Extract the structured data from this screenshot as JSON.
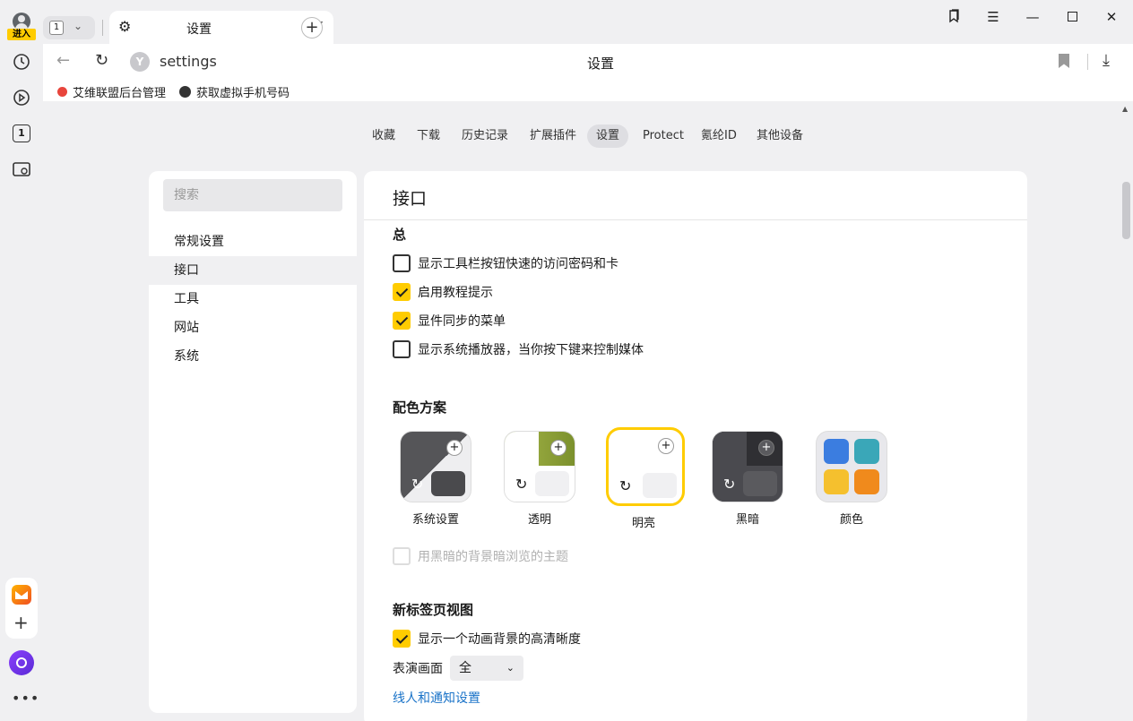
{
  "rail": {
    "enter_badge": "进入",
    "items": [
      "history-icon",
      "media-play-icon",
      "tab-count-icon",
      "screenshot-icon"
    ],
    "tab_count_badge": "1",
    "bottom": [
      "mail-app-icon",
      "add-app-icon",
      "alice-assistant-icon",
      "more-icon"
    ]
  },
  "tabstrip": {
    "tab_count": "1",
    "active_tab_title": "设置",
    "new_tab_symbol": "+"
  },
  "addressbar": {
    "url": "settings",
    "page_title": "设置"
  },
  "bookmarks": [
    {
      "label": "艾维联盟后台管理",
      "color": "#e8453c"
    },
    {
      "label": "获取虚拟手机号码",
      "color": "#333333"
    }
  ],
  "topnav": {
    "items": [
      "收藏",
      "下载",
      "历史记录",
      "扩展插件",
      "设置",
      "Protect",
      "氪纶ID",
      "其他设备"
    ],
    "active": "设置"
  },
  "leftnav": {
    "search_placeholder": "搜索",
    "items": [
      "常规设置",
      "接口",
      "工具",
      "网站",
      "系统"
    ],
    "active": "接口"
  },
  "main": {
    "title": "接口",
    "general": {
      "heading": "总",
      "options": [
        {
          "label": "显示工具栏按钮快速的访问密码和卡",
          "checked": false
        },
        {
          "label": "启用教程提示",
          "checked": true
        },
        {
          "label": "显件同步的菜单",
          "checked": true
        },
        {
          "label": "显示系统播放器，当你按下键来控制媒体",
          "checked": false
        }
      ]
    },
    "color_scheme": {
      "heading": "配色方案",
      "themes": [
        "系统设置",
        "透明",
        "明亮",
        "黑暗",
        "颜色"
      ],
      "selected": "明亮",
      "dark_bg_option": {
        "label": "用黑暗的背景暗浏览的主题",
        "checked": false,
        "disabled": true
      }
    },
    "new_tab": {
      "heading": "新标签页视图",
      "options": [
        {
          "label": "显示一个动画背景的高清晰度",
          "checked": true
        }
      ],
      "display_label": "表演画面",
      "display_value": "全",
      "link": "线人和通知设置"
    }
  },
  "colors": {
    "accent": "#ffcc00",
    "link": "#1a73c8",
    "panel_bg": "#ffffff",
    "page_bg": "#f0f0f2"
  }
}
